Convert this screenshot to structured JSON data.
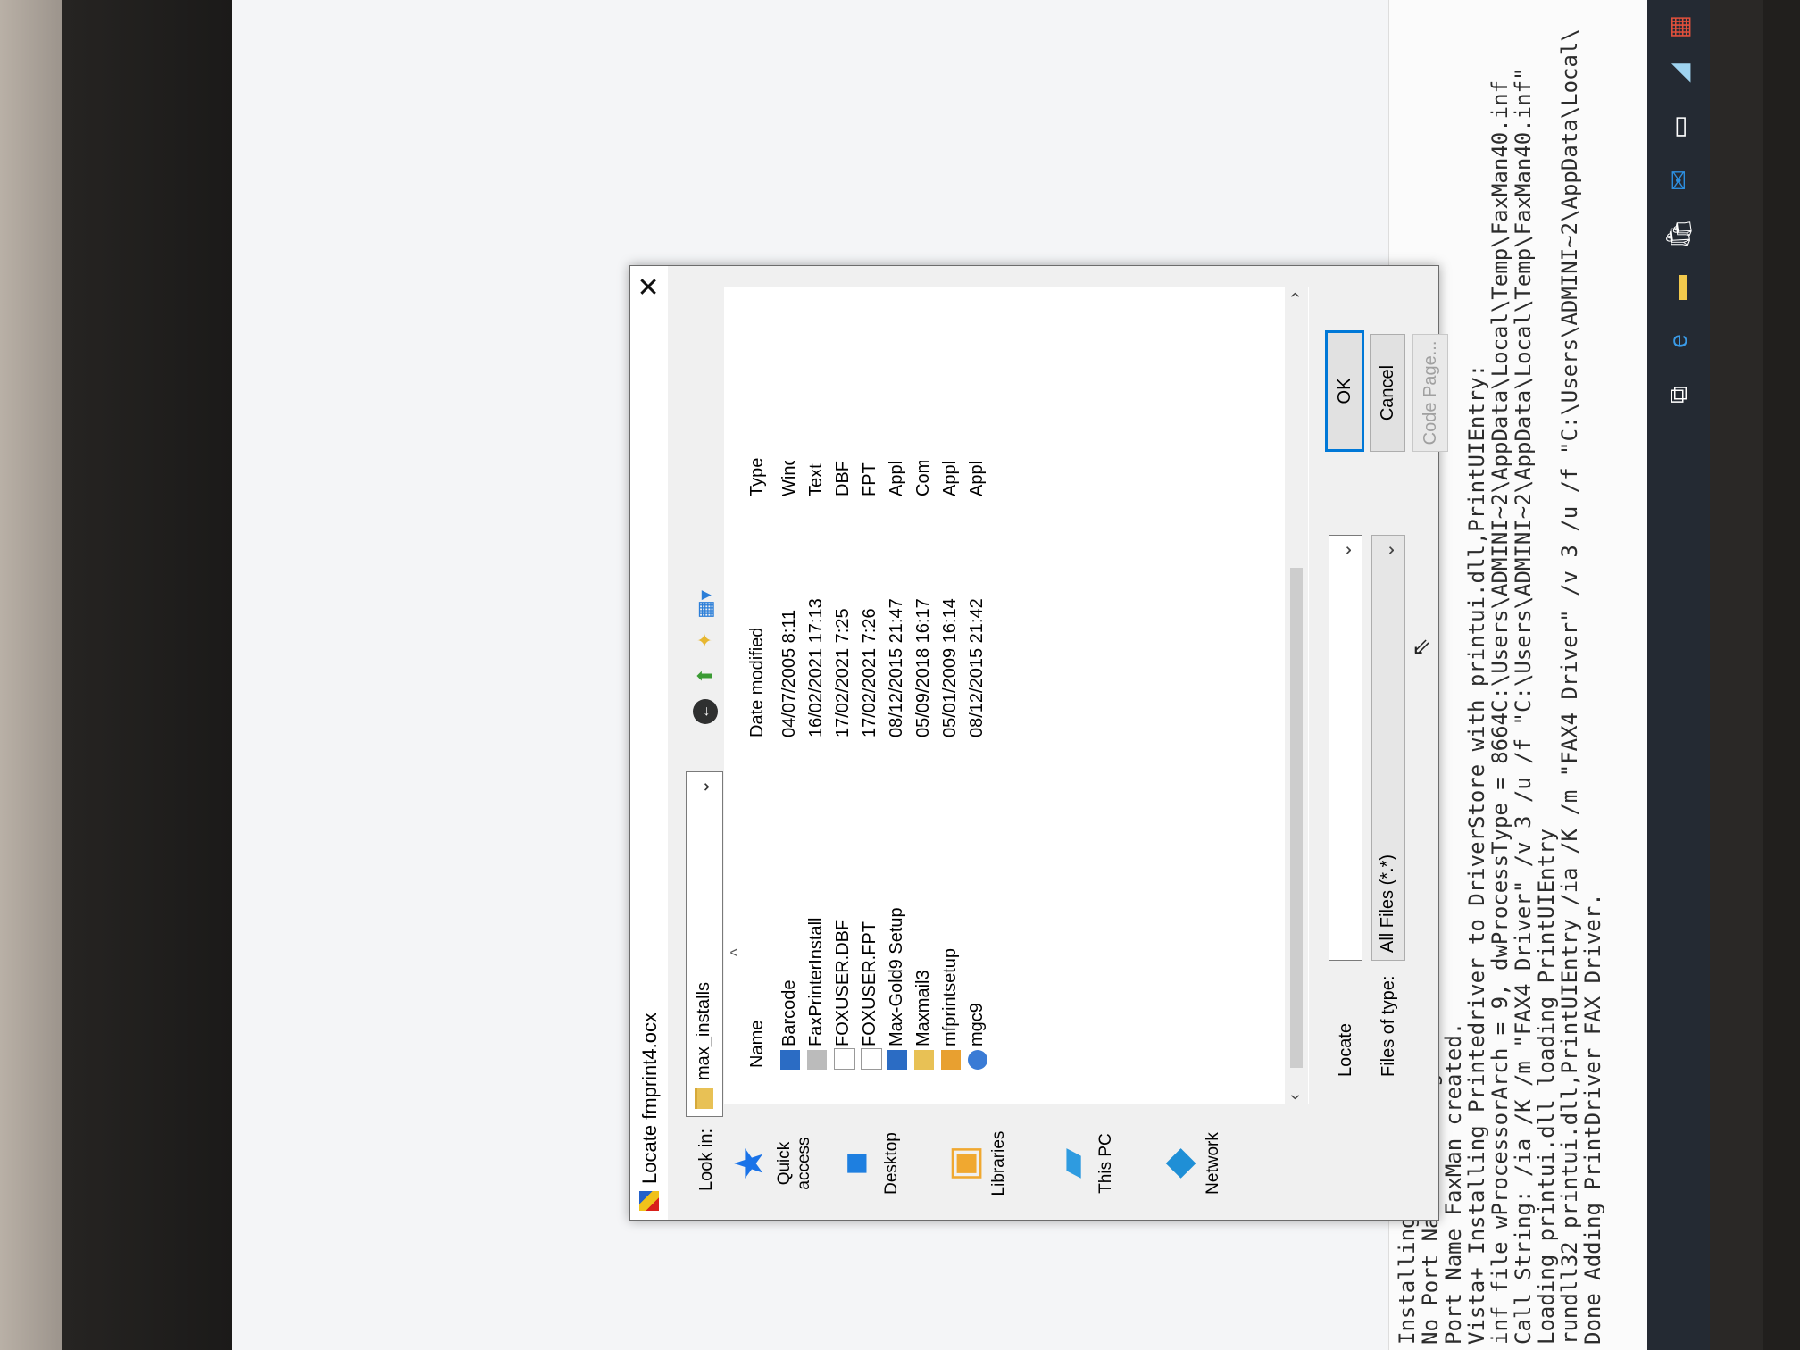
{
  "console": {
    "lines": [
      "Installing Printer Driver.",
      "No Port Name Creating One.",
      "Port Name FaxMan created.",
      "Vista+ Installing Printedriver to DriverStore with printui.dll,PrintUIEntry:",
      "inf file wProcessorArch = 9, dwProcessType = 8664C:\\Users\\ADMINI~2\\AppData\\Local\\Temp\\FaxMan40.inf",
      "Call String: /ia /K /m \"FAX4 Driver\" /v 3 /u /f \"C:\\Users\\ADMINI~2\\AppData\\Local\\Temp\\FaxMan40.inf\"",
      "Loading printui.dll loading PrintUIEntry",
      "rundll32 printui.dll,PrintUIEntry /ia /K /m \"FAX4 Driver\" /v 3 /u /f \"C:\\Users\\ADMINI~2\\AppData\\Local\\",
      "Done Adding PrintDriver FAX Driver."
    ]
  },
  "dialog": {
    "title": "Locate fmprint4.ocx",
    "close_glyph": "✕",
    "look_in_label": "Look in:",
    "look_in_value": "max_installs",
    "places": [
      {
        "label": "Quick access",
        "icon": "star-icon",
        "glyph": "★",
        "color": "#1a73e8"
      },
      {
        "label": "Desktop",
        "icon": "desktop-icon",
        "glyph": "■",
        "color": "#1e7fe0"
      },
      {
        "label": "Libraries",
        "icon": "libraries-icon",
        "glyph": "▣",
        "color": "#f0a830"
      },
      {
        "label": "This PC",
        "icon": "computer-icon",
        "glyph": "▰",
        "color": "#2e9be0"
      },
      {
        "label": "Network",
        "icon": "network-icon",
        "glyph": "◆",
        "color": "#1f8fd6"
      }
    ],
    "columns": {
      "name": "Name",
      "date": "Date modified",
      "type": "Type"
    },
    "files": [
      {
        "name": "Barcode",
        "date": "04/07/2005 8:11",
        "type": "Wind",
        "icon": "application-icon",
        "color": "#2b6cc4"
      },
      {
        "name": "FaxPrinterInstall",
        "date": "16/02/2021 17:13",
        "type": "Text [",
        "icon": "text-file-icon",
        "color": "#bbbbbb"
      },
      {
        "name": "FOXUSER.DBF",
        "date": "17/02/2021 7:25",
        "type": "DBF F",
        "icon": "file-icon",
        "color": "#dddddd"
      },
      {
        "name": "FOXUSER.FPT",
        "date": "17/02/2021 7:26",
        "type": "FPT F",
        "icon": "file-icon",
        "color": "#dddddd"
      },
      {
        "name": "Max-Gold9 Setup",
        "date": "08/12/2015 21:47",
        "type": "Appli",
        "icon": "setup-icon",
        "color": "#2b6cc4"
      },
      {
        "name": "Maxmail3",
        "date": "05/09/2018 16:17",
        "type": "Com",
        "icon": "mail-icon",
        "color": "#e8c155"
      },
      {
        "name": "mfprintsetup",
        "date": "05/01/2009 16:14",
        "type": "Appli",
        "icon": "printer-setup-icon",
        "color": "#e8a030"
      },
      {
        "name": "mgc9",
        "date": "08/12/2015 21:42",
        "type": "Appli",
        "icon": "app-icon",
        "color": "#3a7bd5"
      }
    ],
    "locate_label": "Locate",
    "locate_value": "",
    "files_of_type_label": "Files of type:",
    "files_of_type_value": "All Files (*.*)",
    "ok_label": "OK",
    "cancel_label": "Cancel",
    "code_page_label": "Code Page..."
  },
  "taskbar": {
    "icons": [
      {
        "name": "task-view-icon",
        "glyph": "⧉",
        "color": "#ffffff"
      },
      {
        "name": "edge-icon",
        "glyph": "e",
        "color": "#3a9be8"
      },
      {
        "name": "file-explorer-icon",
        "glyph": "▬",
        "color": "#f2c94c"
      },
      {
        "name": "store-icon",
        "glyph": "🛍",
        "color": "#ffffff"
      },
      {
        "name": "mail-icon",
        "glyph": "✉",
        "color": "#2d8fe0"
      },
      {
        "name": "terminal-icon",
        "glyph": "▭",
        "color": "#ffffff"
      },
      {
        "name": "app-icon",
        "glyph": "◢",
        "color": "#9fd3f0"
      },
      {
        "name": "faxman-icon",
        "glyph": "▦",
        "color": "#e0503c"
      }
    ]
  }
}
